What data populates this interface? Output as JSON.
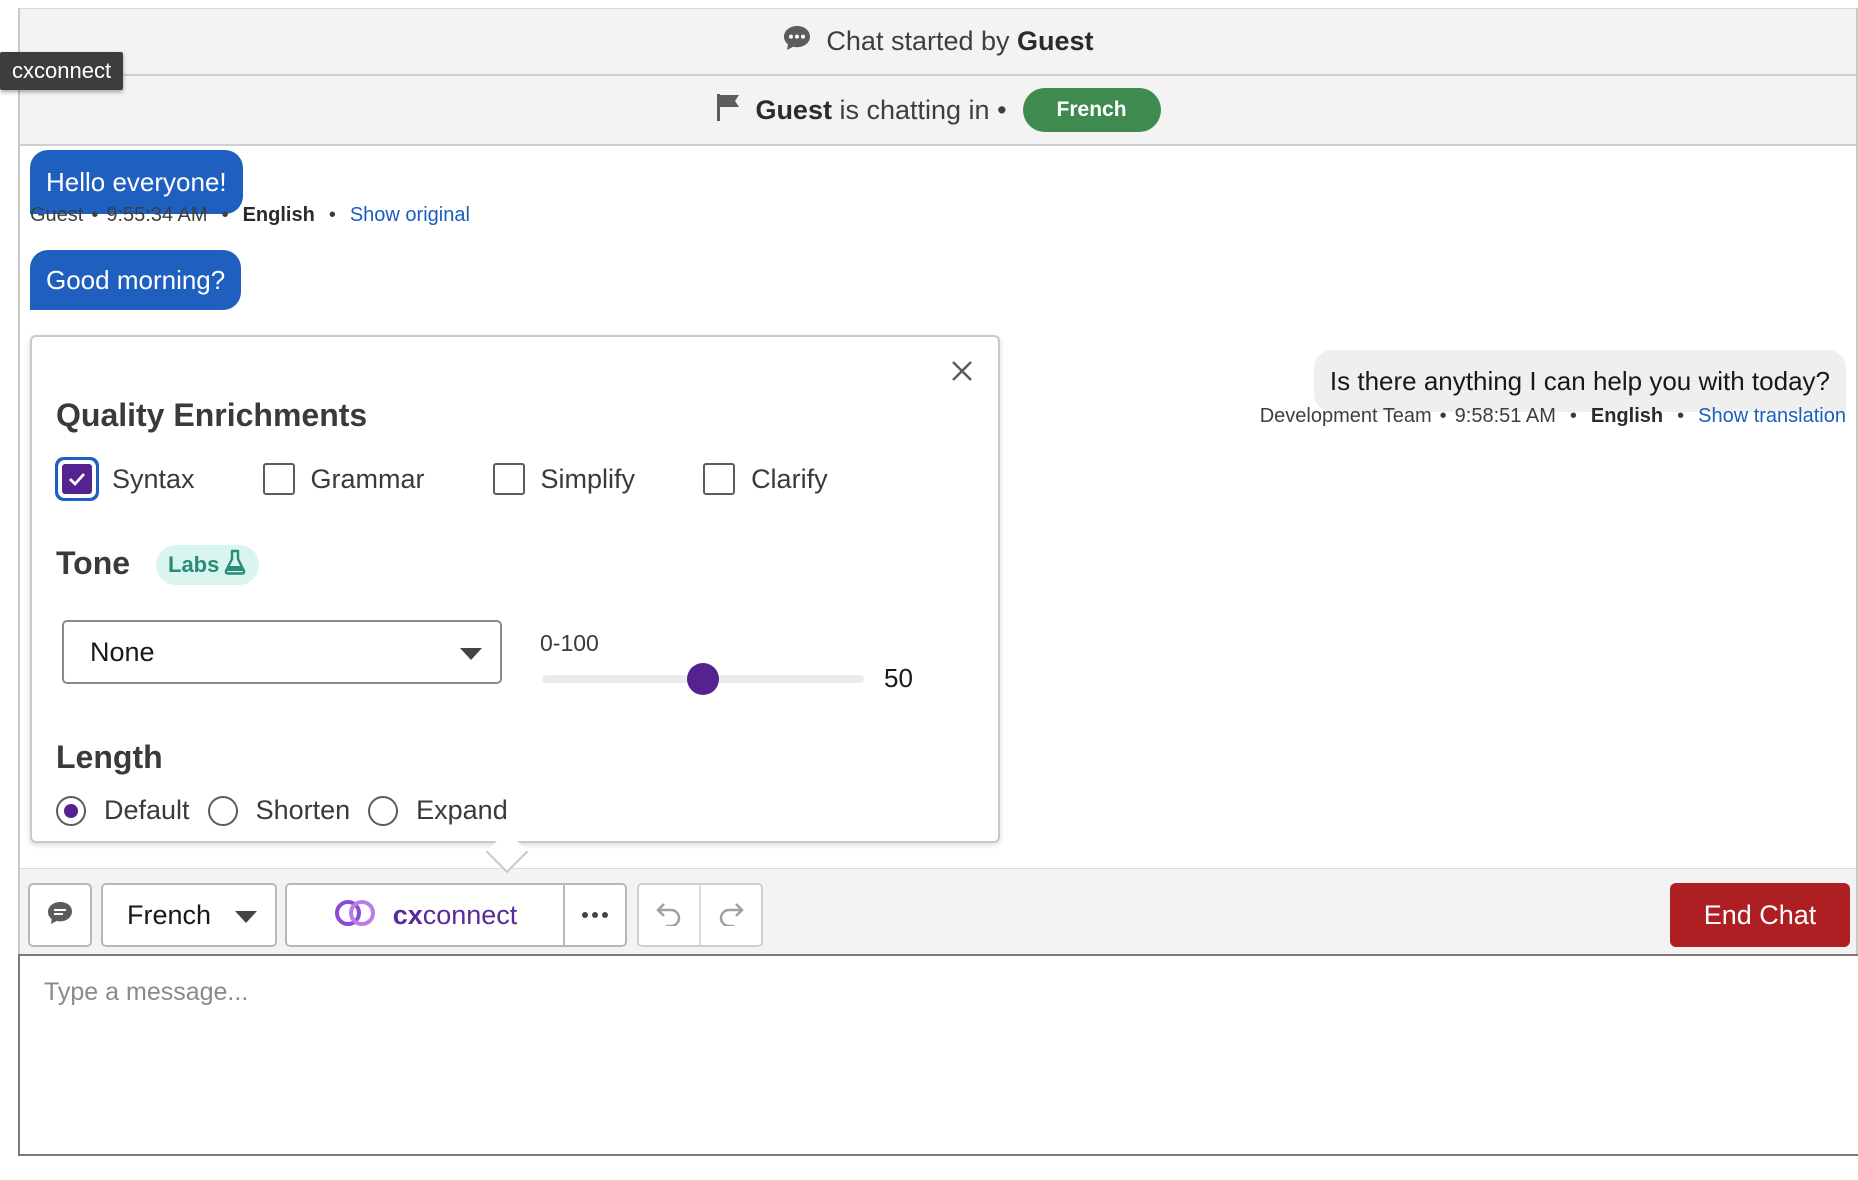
{
  "tooltip": "cxconnect",
  "header": {
    "started_prefix": "Chat started by",
    "started_by": "Guest",
    "chatting_name": "Guest",
    "chatting_text": "is chatting in •",
    "chatting_language": "French"
  },
  "messages": [
    {
      "text": "Hello everyone!",
      "sender": "Guest",
      "time": "9:55:34 AM",
      "language": "English",
      "link": "Show original"
    },
    {
      "text": "Good morning?"
    },
    {
      "text": "Is there anything I can help you with today?",
      "sender": "Development Team",
      "time": "9:58:51 AM",
      "language": "English",
      "link": "Show translation"
    }
  ],
  "popover": {
    "quality_title": "Quality Enrichments",
    "checkboxes": [
      {
        "label": "Syntax",
        "checked": true
      },
      {
        "label": "Grammar",
        "checked": false
      },
      {
        "label": "Simplify",
        "checked": false
      },
      {
        "label": "Clarify",
        "checked": false
      }
    ],
    "tone_title": "Tone",
    "labs_badge": "Labs",
    "tone_value": "None",
    "range_label": "0-100",
    "slider_value": "50",
    "slider_fraction": 0.5,
    "length_title": "Length",
    "length_options": [
      {
        "label": "Default",
        "selected": true
      },
      {
        "label": "Shorten",
        "selected": false
      },
      {
        "label": "Expand",
        "selected": false
      }
    ]
  },
  "toolbar": {
    "language": "French",
    "cx_prefix": "cx",
    "cx_suffix": "connect",
    "end_chat": "End Chat"
  },
  "composer": {
    "placeholder": "Type a message..."
  },
  "colors": {
    "brand_purple": "#54238f",
    "end_chat_red": "#ae1f23",
    "french_green": "#3e8a4f",
    "guest_bubble_blue": "#1f5fbf"
  }
}
